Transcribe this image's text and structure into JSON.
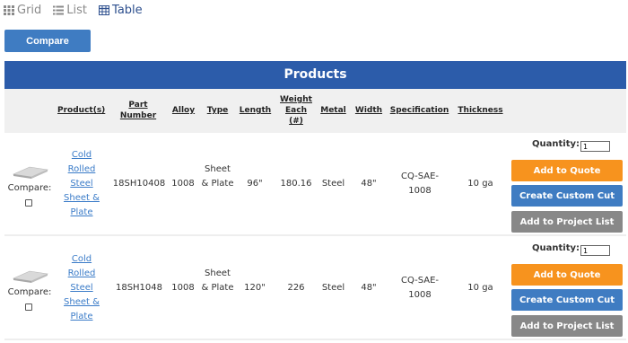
{
  "view_toggle": {
    "grid": "Grid",
    "list": "List",
    "table": "Table",
    "active": "table"
  },
  "compare_button": "Compare",
  "products_title": "Products",
  "columns": {
    "products": "Product(s)",
    "part_number": "Part Number",
    "alloy": "Alloy",
    "type": "Type",
    "length": "Length",
    "weight_each": "Weight Each (#)",
    "metal": "Metal",
    "width": "Width",
    "specification": "Specification",
    "thickness": "Thickness"
  },
  "rows": [
    {
      "compare_label": "Compare:",
      "product_name": "Cold Rolled Steel Sheet & Plate",
      "part_number": "18SH10408",
      "alloy": "1008",
      "type": "Sheet & Plate",
      "length": "96\"",
      "weight_each": "180.16",
      "metal": "Steel",
      "width": "48\"",
      "specification": "CQ-SAE-1008",
      "thickness": "10 ga",
      "quantity_label": "Quantity:",
      "quantity_value": "1",
      "add_to_quote": "Add to Quote",
      "create_custom_cut": "Create Custom Cut",
      "add_to_project_list": "Add to Project List"
    },
    {
      "compare_label": "Compare:",
      "product_name": "Cold Rolled Steel Sheet & Plate",
      "part_number": "18SH1048",
      "alloy": "1008",
      "type": "Sheet & Plate",
      "length": "120\"",
      "weight_each": "226",
      "metal": "Steel",
      "width": "48\"",
      "specification": "CQ-SAE-1008",
      "thickness": "10 ga",
      "quantity_label": "Quantity:",
      "quantity_value": "1",
      "add_to_quote": "Add to Quote",
      "create_custom_cut": "Create Custom Cut",
      "add_to_project_list": "Add to Project List"
    }
  ],
  "colors": {
    "header_blue": "#2c5caa",
    "button_blue": "#3f7cc2",
    "quote_orange": "#f7931e",
    "project_gray": "#888888",
    "link_blue": "#3a7bc8"
  },
  "icons": {
    "grid": "grid-icon",
    "list": "list-icon",
    "table": "table-icon",
    "product_thumbnail": "steel-sheet-thumbnail"
  }
}
